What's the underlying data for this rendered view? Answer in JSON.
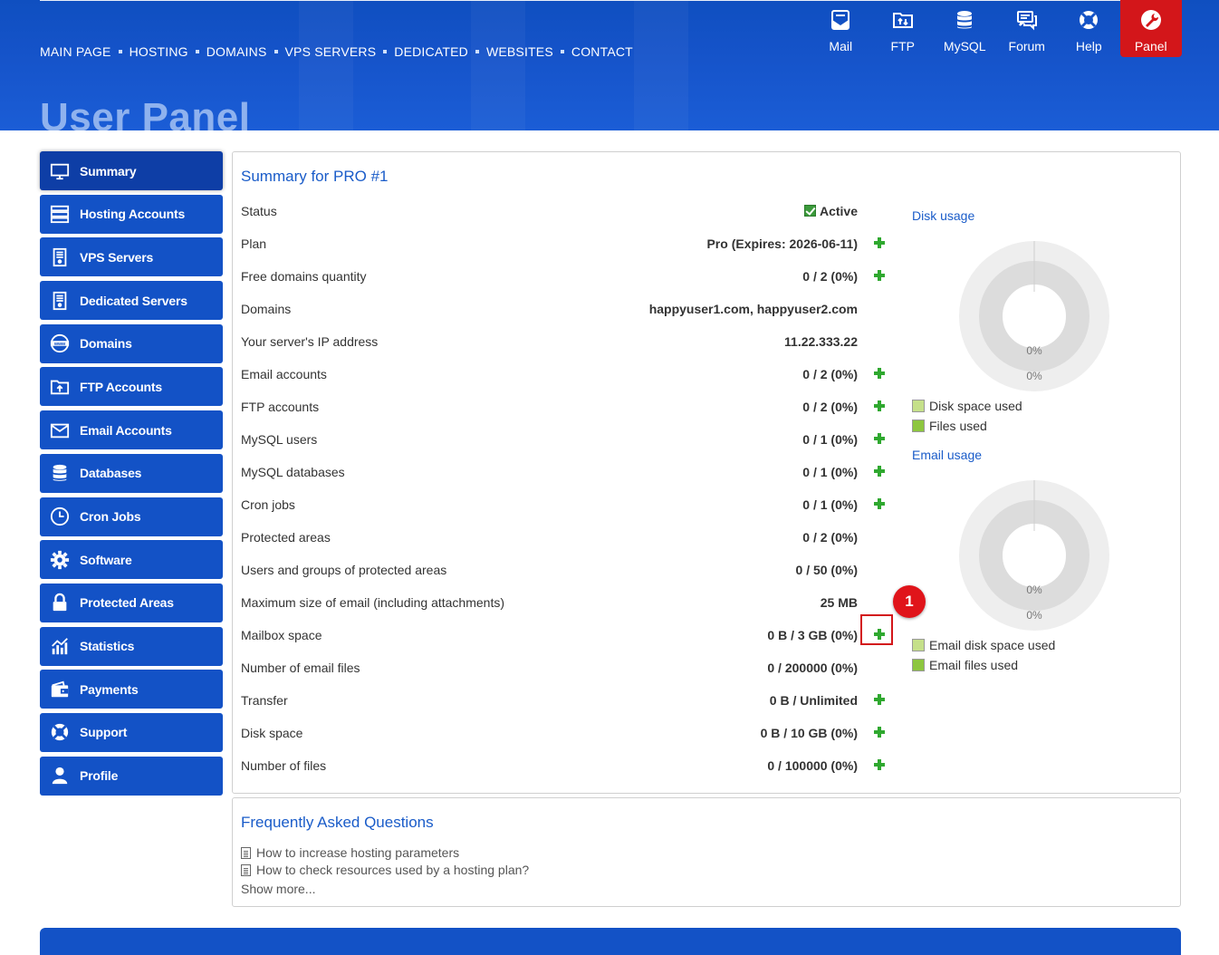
{
  "topnav": [
    {
      "label": "MAIN PAGE"
    },
    {
      "label": "HOSTING"
    },
    {
      "label": "DOMAINS"
    },
    {
      "label": "VPS SERVERS"
    },
    {
      "label": "DEDICATED"
    },
    {
      "label": "WEBSITES"
    },
    {
      "label": "CONTACT"
    }
  ],
  "quick": [
    {
      "label": "Mail",
      "icon": "mail-icon"
    },
    {
      "label": "FTP",
      "icon": "ftp-icon"
    },
    {
      "label": "MySQL",
      "icon": "database-icon"
    },
    {
      "label": "Forum",
      "icon": "forum-icon"
    },
    {
      "label": "Help",
      "icon": "lifebuoy-icon"
    },
    {
      "label": "Panel",
      "icon": "wrench-icon"
    }
  ],
  "page_title": "User Panel",
  "sidebar": [
    {
      "label": "Summary",
      "icon": "monitor-icon"
    },
    {
      "label": "Hosting Accounts",
      "icon": "server-rack-icon"
    },
    {
      "label": "VPS Servers",
      "icon": "server-tower-icon"
    },
    {
      "label": "Dedicated Servers",
      "icon": "server-tower-icon"
    },
    {
      "label": "Domains",
      "icon": "www-globe-icon"
    },
    {
      "label": "FTP Accounts",
      "icon": "folder-upload-icon"
    },
    {
      "label": "Email Accounts",
      "icon": "envelope-icon"
    },
    {
      "label": "Databases",
      "icon": "database-icon"
    },
    {
      "label": "Cron Jobs",
      "icon": "clock-icon"
    },
    {
      "label": "Software",
      "icon": "gear-icon"
    },
    {
      "label": "Protected Areas",
      "icon": "padlock-icon"
    },
    {
      "label": "Statistics",
      "icon": "stats-chart-icon"
    },
    {
      "label": "Payments",
      "icon": "wallet-icon"
    },
    {
      "label": "Support",
      "icon": "lifebuoy-icon"
    },
    {
      "label": "Profile",
      "icon": "user-icon"
    }
  ],
  "summary": {
    "title": "Summary for PRO #1",
    "rows": [
      {
        "label": "Status",
        "value": "Active",
        "plus": false,
        "check": true
      },
      {
        "label": "Plan",
        "value": "Pro (Expires: 2026-06-11)",
        "plus": true
      },
      {
        "label": "Free domains quantity",
        "value": "0 / 2 (0%)",
        "plus": true
      },
      {
        "label": "Domains",
        "value": "happyuser1.com, happyuser2.com",
        "plus": false
      },
      {
        "label": "Your server's IP address",
        "value": "11.22.333.22",
        "plus": false
      },
      {
        "label": "Email accounts",
        "value": "0 / 2 (0%)",
        "plus": true
      },
      {
        "label": "FTP accounts",
        "value": "0 / 2 (0%)",
        "plus": true
      },
      {
        "label": "MySQL users",
        "value": "0 / 1 (0%)",
        "plus": true
      },
      {
        "label": "MySQL databases",
        "value": "0 / 1 (0%)",
        "plus": true
      },
      {
        "label": "Cron jobs",
        "value": "0 / 1 (0%)",
        "plus": true
      },
      {
        "label": "Protected areas",
        "value": "0 / 2 (0%)",
        "plus": false
      },
      {
        "label": "Users and groups of protected areas",
        "value": "0 / 50 (0%)",
        "plus": false
      },
      {
        "label": "Maximum size of email (including attachments)",
        "value": "25 MB",
        "plus": false
      },
      {
        "label": "Mailbox space",
        "value": "0 B / 3 GB (0%)",
        "plus": true,
        "highlight": true
      },
      {
        "label": "Number of email files",
        "value": "0 / 200000 (0%)",
        "plus": false
      },
      {
        "label": "Transfer",
        "value": "0 B / Unlimited",
        "plus": true
      },
      {
        "label": "Disk space",
        "value": "0 B / 10 GB (0%)",
        "plus": true
      },
      {
        "label": "Number of files",
        "value": "0 / 100000 (0%)",
        "plus": true
      }
    ],
    "annotation_badge": "1"
  },
  "disk_usage": {
    "title": "Disk usage",
    "inner_pct": "0%",
    "outer_pct": "0%",
    "legend": [
      {
        "label": "Disk space used",
        "color": "#c5e08a"
      },
      {
        "label": "Files used",
        "color": "#8dc63f"
      }
    ]
  },
  "email_usage": {
    "title": "Email usage",
    "inner_pct": "0%",
    "outer_pct": "0%",
    "legend": [
      {
        "label": "Email disk space used",
        "color": "#c5e08a"
      },
      {
        "label": "Email files used",
        "color": "#8dc63f"
      }
    ]
  },
  "faq": {
    "title": "Frequently Asked Questions",
    "links": [
      "How to increase hosting parameters",
      "How to check resources used by a hosting plan?"
    ],
    "more": "Show more..."
  },
  "colors": {
    "brand_blue": "#1352c6",
    "accent_red": "#d3161a",
    "plus_green": "#2fa82f",
    "link_blue": "#1a5cc9"
  }
}
